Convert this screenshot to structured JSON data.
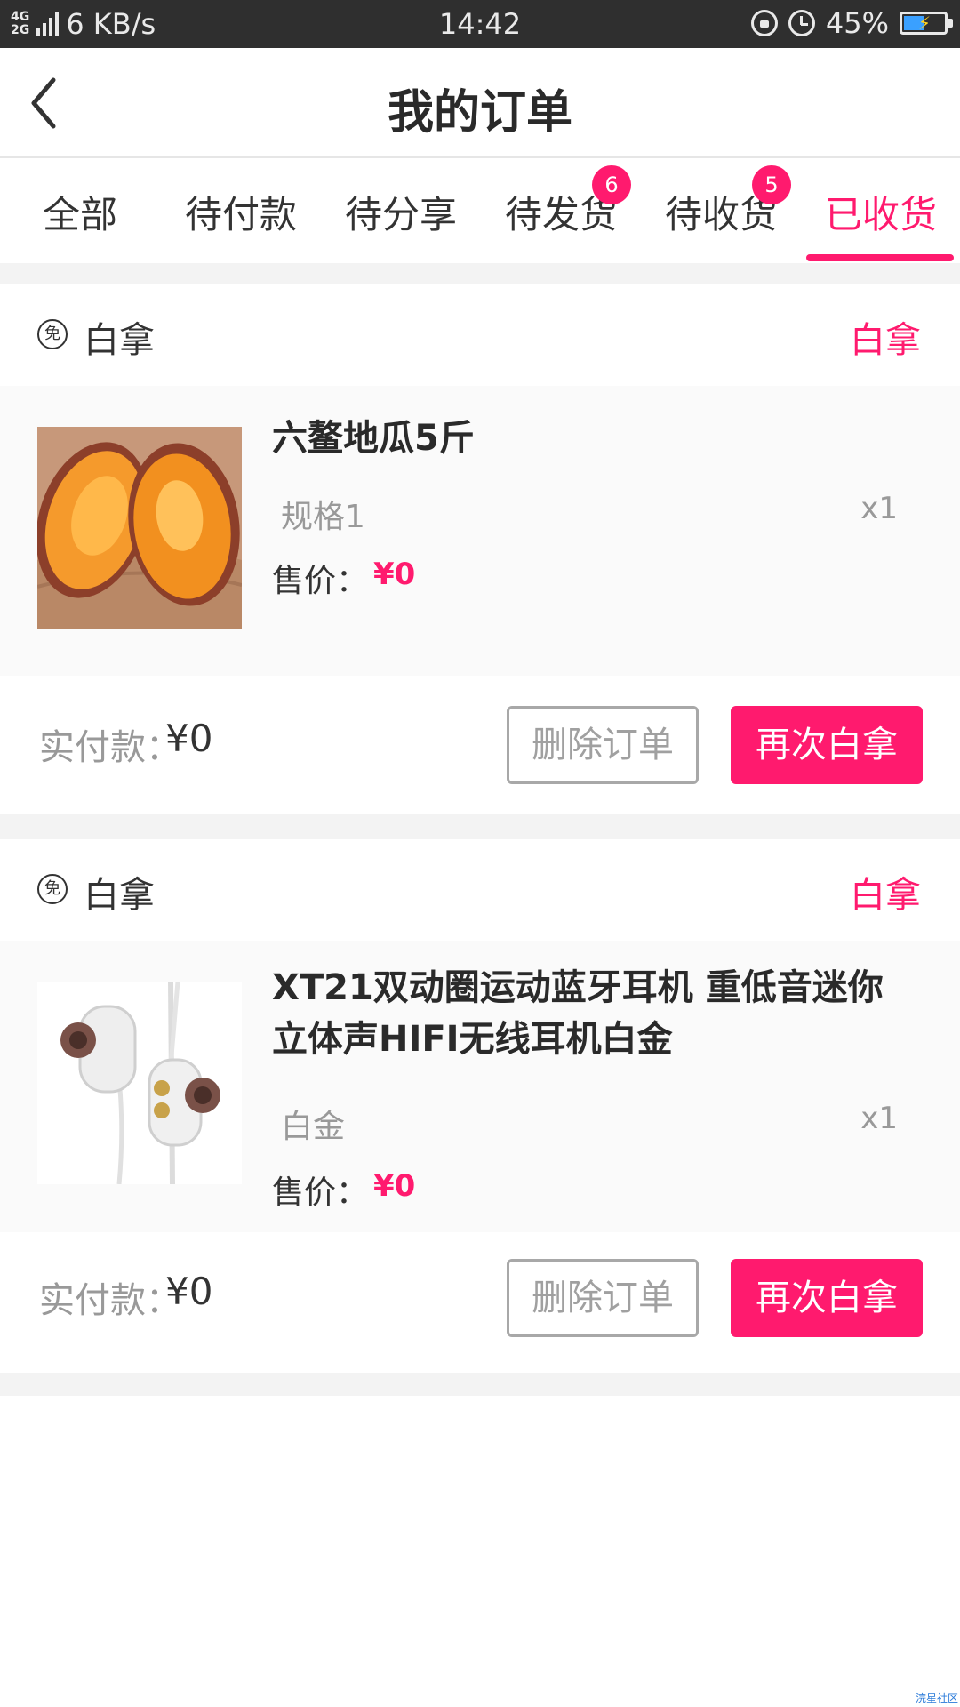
{
  "status_bar": {
    "network_top": "4G",
    "network_bottom": "2G",
    "speed": "6 KB/s",
    "time": "14:42",
    "battery": "45%"
  },
  "header": {
    "title": "我的订单",
    "back_icon": "chevron-left-icon"
  },
  "tabs": [
    {
      "label": "全部"
    },
    {
      "label": "待付款"
    },
    {
      "label": "待分享"
    },
    {
      "label": "待发货",
      "badge": "6"
    },
    {
      "label": "待收货",
      "badge": "5"
    },
    {
      "label": "已收货",
      "active": true
    }
  ],
  "orders": [
    {
      "shop_icon": "免",
      "shop_name": "白拿",
      "status": "白拿",
      "item": {
        "title": "六鳌地瓜5斤",
        "spec": "规格1",
        "qty": "x1",
        "price_label": "售价：",
        "price": "¥0"
      },
      "paid_label": "实付款：",
      "paid_value": "¥0",
      "delete_label": "删除订单",
      "again_label": "再次白拿"
    },
    {
      "shop_icon": "免",
      "shop_name": "白拿",
      "status": "白拿",
      "item": {
        "title": "XT21双动圈运动蓝牙耳机 重低音迷你立体声HIFI无线耳机白金",
        "spec": "白金",
        "qty": "x1",
        "price_label": "售价：",
        "price": "¥0"
      },
      "paid_label": "实付款：",
      "paid_value": "¥0",
      "delete_label": "删除订单",
      "again_label": "再次白拿"
    }
  ],
  "colors": {
    "accent": "#ff1a6e",
    "status_bar_bg": "#2f2f2f",
    "section_gap": "#f3f3f3"
  },
  "watermark": "浣星社区"
}
